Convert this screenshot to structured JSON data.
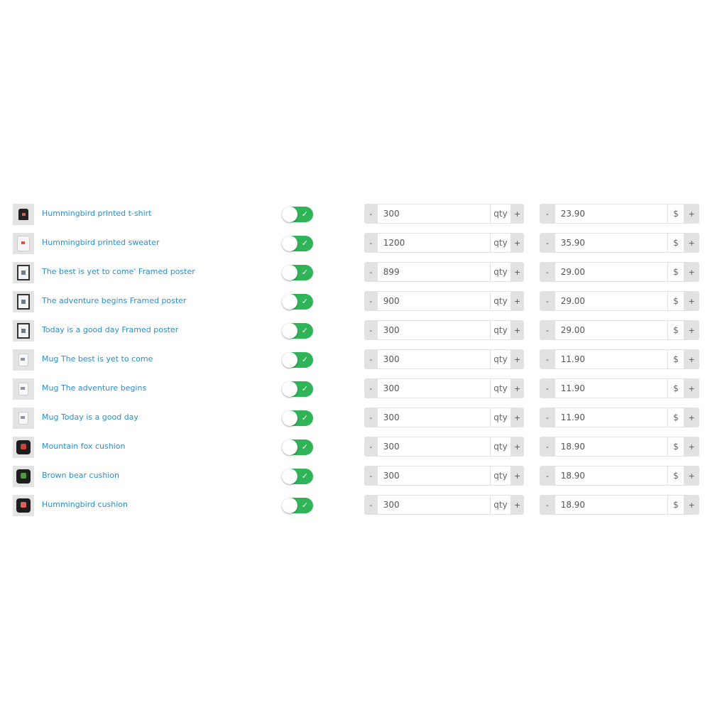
{
  "theme": {
    "link_color": "#2a8fce",
    "toggle_on_color": "#2fb457",
    "stepper_bg": "#e2e2e2"
  },
  "controls": {
    "minus_label": "-",
    "plus_label": "+",
    "check_glyph": "✓",
    "qty_unit": "qty",
    "price_unit": "$"
  },
  "products": [
    {
      "name": "Hummingbird printed t-shirt",
      "thumb_icon": "tshirt-thumbnail-icon",
      "thumb": "tshirt",
      "enabled": true,
      "quantity": "300",
      "price": "23.90"
    },
    {
      "name": "Hummingbird printed sweater",
      "thumb_icon": "sweater-thumbnail-icon",
      "thumb": "sweater",
      "enabled": true,
      "quantity": "1200",
      "price": "35.90"
    },
    {
      "name": "The best is yet to come' Framed poster",
      "thumb_icon": "poster-thumbnail-icon",
      "thumb": "poster",
      "enabled": true,
      "quantity": "899",
      "price": "29.00"
    },
    {
      "name": "The adventure begins Framed poster",
      "thumb_icon": "poster-thumbnail-icon",
      "thumb": "poster",
      "enabled": true,
      "quantity": "900",
      "price": "29.00"
    },
    {
      "name": "Today is a good day Framed poster",
      "thumb_icon": "poster-thumbnail-icon",
      "thumb": "poster",
      "enabled": true,
      "quantity": "300",
      "price": "29.00"
    },
    {
      "name": "Mug The best is yet to come",
      "thumb_icon": "mug-thumbnail-icon",
      "thumb": "mug",
      "enabled": true,
      "quantity": "300",
      "price": "11.90"
    },
    {
      "name": "Mug The adventure begins",
      "thumb_icon": "mug-thumbnail-icon",
      "thumb": "mug",
      "enabled": true,
      "quantity": "300",
      "price": "11.90"
    },
    {
      "name": "Mug Today is a good day",
      "thumb_icon": "mug-thumbnail-icon",
      "thumb": "mug",
      "enabled": true,
      "quantity": "300",
      "price": "11.90"
    },
    {
      "name": "Mountain fox cushion",
      "thumb_icon": "cushion-thumbnail-icon",
      "thumb": "cushion",
      "accent": "#c9433a",
      "enabled": true,
      "quantity": "300",
      "price": "18.90"
    },
    {
      "name": "Brown bear cushion",
      "thumb_icon": "cushion-thumbnail-icon",
      "thumb": "cushion",
      "accent": "#4f9a3a",
      "enabled": true,
      "quantity": "300",
      "price": "18.90"
    },
    {
      "name": "Hummingbird cushion",
      "thumb_icon": "cushion-thumbnail-icon",
      "thumb": "cushion",
      "accent": "#e06060",
      "enabled": true,
      "quantity": "300",
      "price": "18.90"
    }
  ]
}
